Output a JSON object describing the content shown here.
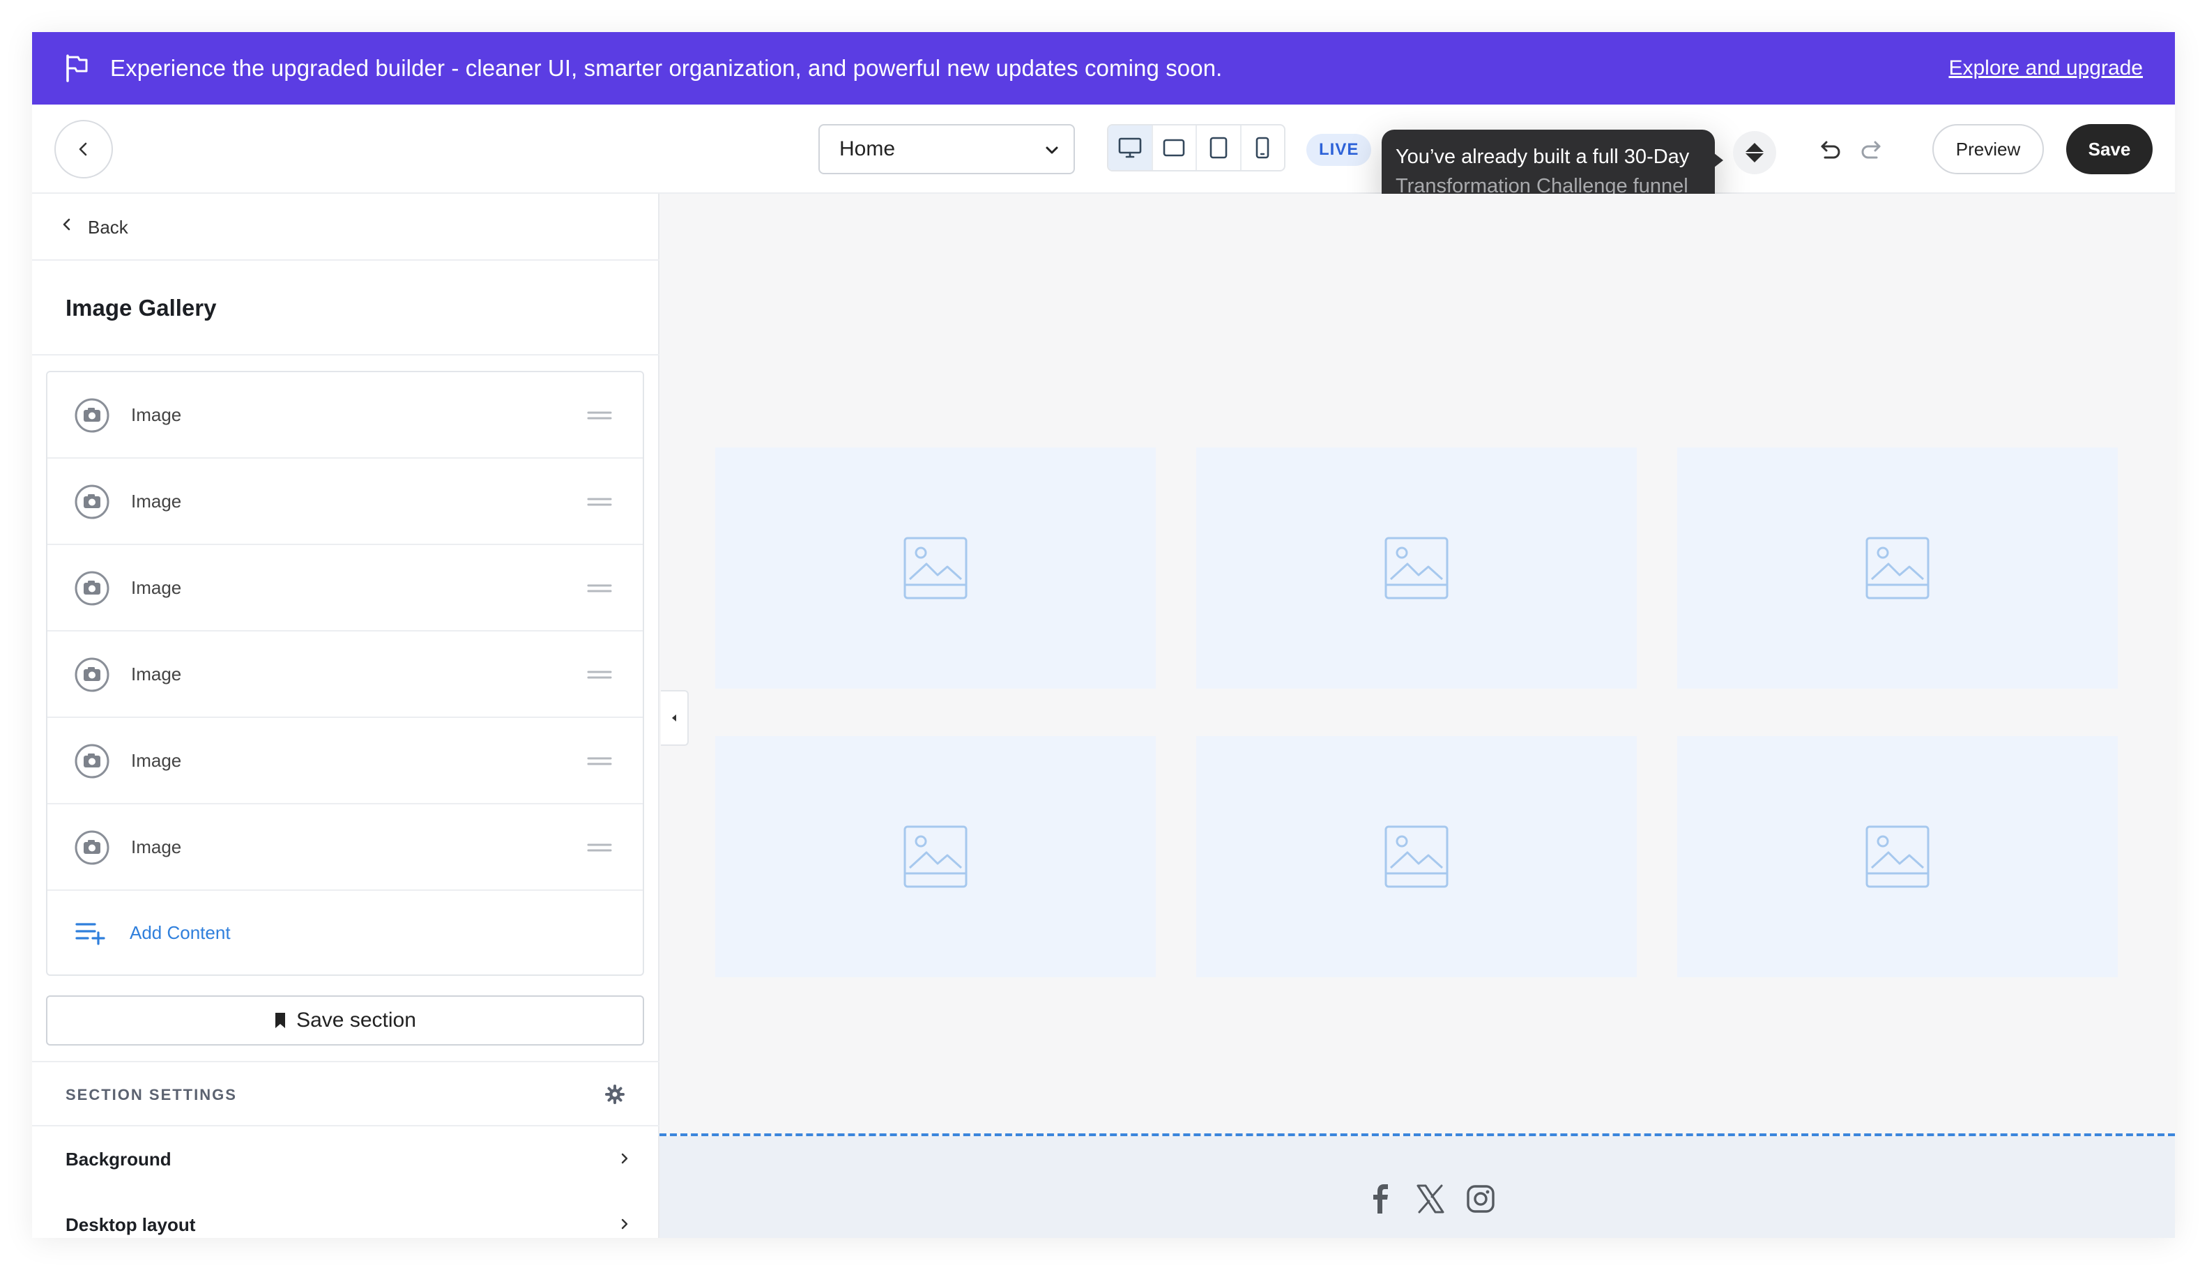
{
  "banner": {
    "message": "Experience the upgraded builder - cleaner UI, smarter organization, and powerful new updates coming soon.",
    "link": "Explore and upgrade",
    "bg_color": "#5b3de3"
  },
  "toolbar": {
    "page_select": {
      "value": "Home",
      "options": [
        "Home"
      ]
    },
    "devices": [
      "desktop",
      "tablet-landscape",
      "tablet-portrait",
      "mobile"
    ],
    "active_device": "desktop",
    "status_badge": "LIVE",
    "tooltip": {
      "line1": "You’ve already built a full 30-Day",
      "line2": "Transformation Challenge funnel"
    },
    "preview_label": "Preview",
    "save_label": "Save"
  },
  "panel": {
    "back_label": "Back",
    "title": "Image Gallery",
    "items": [
      {
        "label": "Image"
      },
      {
        "label": "Image"
      },
      {
        "label": "Image"
      },
      {
        "label": "Image"
      },
      {
        "label": "Image"
      },
      {
        "label": "Image"
      }
    ],
    "add_content": "Add Content",
    "save_section": "Save section",
    "section_settings": "SECTION SETTINGS",
    "settings_rows": [
      "Background",
      "Desktop layout"
    ]
  },
  "canvas": {
    "gallery_cells": 6,
    "social_icons": [
      "facebook-icon",
      "x-icon",
      "instagram-icon"
    ]
  }
}
